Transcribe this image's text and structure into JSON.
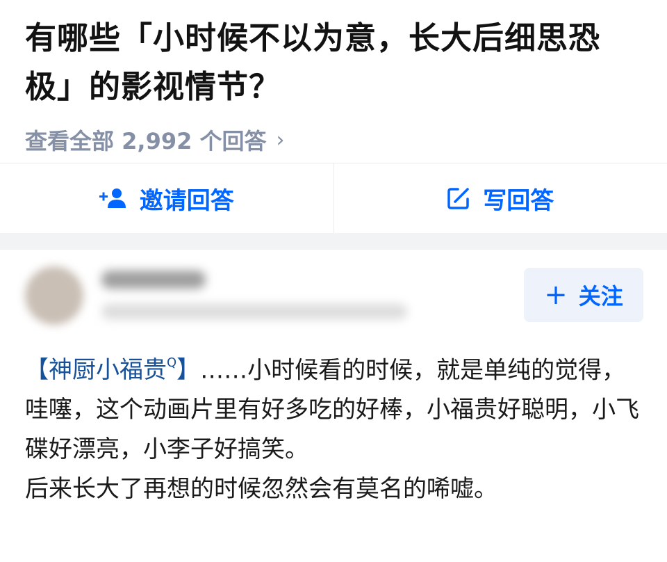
{
  "question": {
    "title": "有哪些「小时候不以为意，长大后细思恐极」的影视情节？",
    "view_all_label": "查看全部 2,992 个回答",
    "view_all_chevron": "›"
  },
  "actions": {
    "invite_label": "邀请回答",
    "write_label": "写回答"
  },
  "answer": {
    "follow_label": "关注",
    "follow_plus": "+",
    "body": {
      "link_open": "【",
      "link_text": "神厨小福贵",
      "link_marker": "Q",
      "link_close": "】",
      "paragraph1_rest": "……小时候看的时候，就是单纯的觉得，哇噻，这个动画片里有好多吃的好棒，小福贵好聪明，小飞碟好漂亮，小李子好搞笑。",
      "paragraph2": "后来长大了再想的时候忽然会有莫名的唏嘘。"
    }
  },
  "colors": {
    "accent": "#0066ff",
    "link": "#175199",
    "muted": "#8590a6"
  },
  "icons": [
    "add-user-icon",
    "edit-icon",
    "plus-icon",
    "chevron-right-icon"
  ]
}
